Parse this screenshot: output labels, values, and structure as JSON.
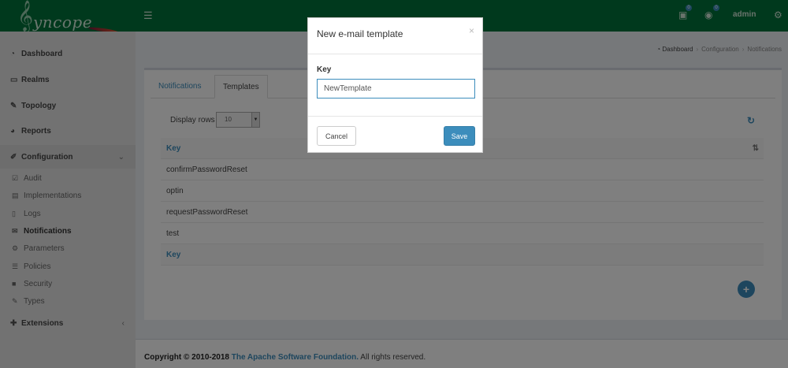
{
  "header": {
    "logo_text": "yncope",
    "logo_clef": "𝄞",
    "menu_icon": "bars-icon",
    "badge_1": "0",
    "badge_2": "0",
    "user": "admin"
  },
  "sidebar": {
    "items": [
      {
        "label": "Dashboard",
        "icon": "dashboard-icon"
      },
      {
        "label": "Realms",
        "icon": "folder-icon"
      },
      {
        "label": "Topology",
        "icon": "wrench-icon"
      },
      {
        "label": "Reports",
        "icon": "pie-chart-icon"
      },
      {
        "label": "Configuration",
        "icon": "edit-icon"
      }
    ],
    "sub_items": [
      {
        "label": "Audit"
      },
      {
        "label": "Implementations"
      },
      {
        "label": "Logs"
      },
      {
        "label": "Notifications"
      },
      {
        "label": "Parameters"
      },
      {
        "label": "Policies"
      },
      {
        "label": "Security"
      },
      {
        "label": "Types"
      }
    ],
    "extensions": "Extensions"
  },
  "breadcrumb": [
    "Dashboard",
    "Configuration",
    "Notifications"
  ],
  "tabs": [
    "Notifications",
    "Templates"
  ],
  "table_controls": {
    "display_rows_label": "Display rows",
    "display_rows_value": "10"
  },
  "table": {
    "header": "Key",
    "rows": [
      "confirmPasswordReset",
      "optin",
      "requestPasswordReset",
      "test"
    ],
    "footer": "Key"
  },
  "footer": {
    "copyright": "Copyright © 2010-2018",
    "org": "The Apache Software Foundation.",
    "rights": "All rights reserved."
  },
  "modal": {
    "title": "New e-mail template",
    "close": "×",
    "key_label": "Key",
    "key_value": "NewTemplate",
    "cancel": "Cancel",
    "save": "Save"
  },
  "colors": {
    "header": "#00733a",
    "accent": "#3c8dbc",
    "sidebar": "#e4e4e4"
  }
}
